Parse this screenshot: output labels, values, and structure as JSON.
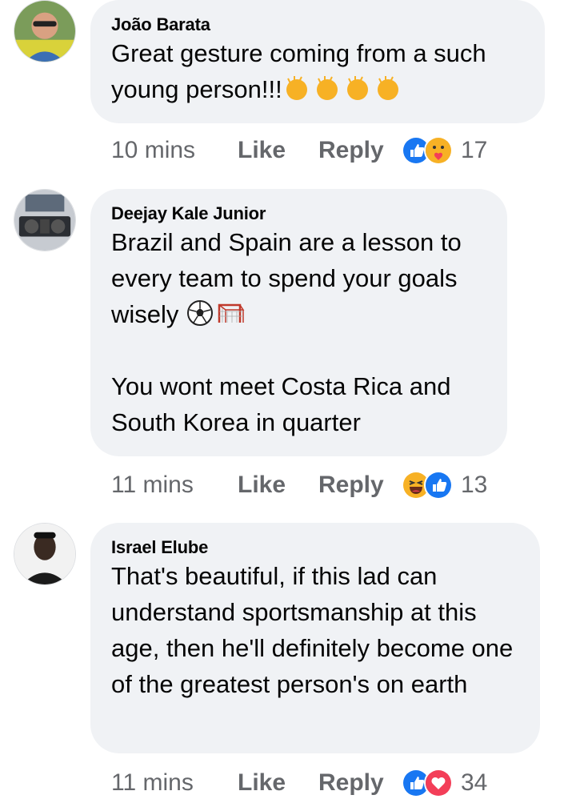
{
  "comments": [
    {
      "author": "João Barata",
      "text": "Great gesture coming from a such young person!!!",
      "emoji_suffix": [
        "clapping-hands-icon",
        "clapping-hands-icon",
        "clapping-hands-icon",
        "clapping-hands-icon"
      ],
      "time": "10 mins",
      "like_label": "Like",
      "reply_label": "Reply",
      "reactions": [
        "like-reaction-icon",
        "care-reaction-icon"
      ],
      "reaction_count": "17"
    },
    {
      "author": "Deejay Kale Junior",
      "text_line1": "Brazil and Spain are a lesson to every team to spend your goals wisely",
      "emoji_suffix": [
        "soccer-ball-icon",
        "goal-net-icon"
      ],
      "text_line2": "You wont meet Costa Rica and South Korea in quarter",
      "time": "11 mins",
      "like_label": "Like",
      "reply_label": "Reply",
      "reactions": [
        "haha-reaction-icon",
        "like-reaction-icon"
      ],
      "reaction_count": "13"
    },
    {
      "author": "Israel Elube",
      "text": "That's beautiful, if this lad can understand sportsmanship at this age, then he'll definitely become one of the greatest person's on earth",
      "time": "11 mins",
      "like_label": "Like",
      "reply_label": "Reply",
      "reactions": [
        "like-reaction-icon",
        "love-reaction-icon"
      ],
      "reaction_count": "34"
    }
  ],
  "colors": {
    "bubble": "#f0f2f5",
    "meta_text": "#65676b",
    "like_blue": "#1877f2",
    "love_red": "#f33e58",
    "emoji_yellow": "#f7b125"
  }
}
